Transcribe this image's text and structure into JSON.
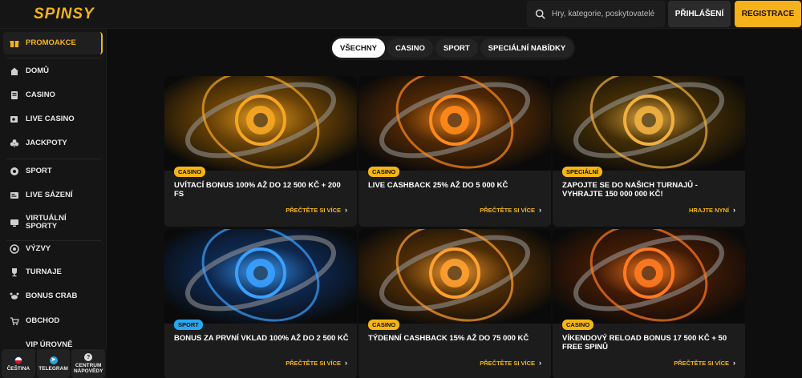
{
  "header": {
    "logo": "SPINSY",
    "search_placeholder": "Hry, kategorie, poskytovatelé",
    "login_label": "PŘIHLÁŠENÍ",
    "register_label": "REGISTRACE"
  },
  "sidebar": {
    "items": [
      {
        "label": "PROMOAKCE",
        "icon": "gift-icon",
        "active": true
      },
      {
        "label": "DOMŮ",
        "icon": "home-icon"
      },
      {
        "label": "CASINO",
        "icon": "casino-icon"
      },
      {
        "label": "LIVE CASINO",
        "icon": "live-casino-icon"
      },
      {
        "label": "JACKPOTY",
        "icon": "jackpot-icon"
      },
      {
        "label": "SPORT",
        "icon": "sport-icon"
      },
      {
        "label": "LIVE SÁZENÍ",
        "icon": "live-betting-icon"
      },
      {
        "label": "VIRTUÁLNÍ SPORTY",
        "icon": "virtual-sports-icon"
      },
      {
        "label": "VÝZVY",
        "icon": "challenges-icon"
      },
      {
        "label": "TURNAJE",
        "icon": "trophy-icon"
      },
      {
        "label": "BONUS CRAB",
        "icon": "crab-icon"
      },
      {
        "label": "OBCHOD",
        "icon": "shop-icon"
      },
      {
        "label": "VIP ÚROVNĚ",
        "icon": "vip-icon"
      }
    ],
    "bottom": [
      {
        "label": "ČEŠTINA",
        "icon": "czech-flag-icon"
      },
      {
        "label": "TELEGRAM",
        "icon": "telegram-icon"
      },
      {
        "label": "CENTRUM NÁPOVĚDY",
        "icon": "help-icon"
      }
    ]
  },
  "tabs": [
    {
      "label": "VŠECHNY",
      "active": true
    },
    {
      "label": "CASINO"
    },
    {
      "label": "SPORT"
    },
    {
      "label": "SPECIÁLNÍ NABÍDKY"
    }
  ],
  "cards": [
    {
      "badge": "CASINO",
      "badge_color": "#f5b515",
      "title": "UVÍTACÍ BONUS 100% AŽ DO 12 500 KČ + 200 FS",
      "link": "PŘEČTĚTE SI VÍCE"
    },
    {
      "badge": "CASINO",
      "badge_color": "#f5b515",
      "title": "LIVE CASHBACK 25% AŽ DO 5 000 KČ",
      "link": "PŘEČTĚTE SI VÍCE"
    },
    {
      "badge": "SPECIÁLNÍ",
      "badge_color": "#f5b515",
      "title": "ZAPOJTE SE DO NAŠICH TURNAJŮ - VYHRAJTE 150 000 000 KČ!",
      "link": "HRAJTE NYNÍ"
    },
    {
      "badge": "SPORT",
      "badge_color": "#29a8f0",
      "title": "BONUS ZA PRVNÍ VKLAD 100% AŽ DO 2 500 KČ",
      "link": "PŘEČTĚTE SI VÍCE"
    },
    {
      "badge": "CASINO",
      "badge_color": "#f5b515",
      "title": "TÝDENNÍ CASHBACK 15% AŽ DO 75 000 KČ",
      "link": "PŘEČTĚTE SI VÍCE"
    },
    {
      "badge": "CASINO",
      "badge_color": "#f5b515",
      "title": "VÍKENDOVÝ RELOAD BONUS 17 500 KČ + 50 FREE SPINŮ",
      "link": "PŘEČTĚTE SI VÍCE"
    }
  ]
}
